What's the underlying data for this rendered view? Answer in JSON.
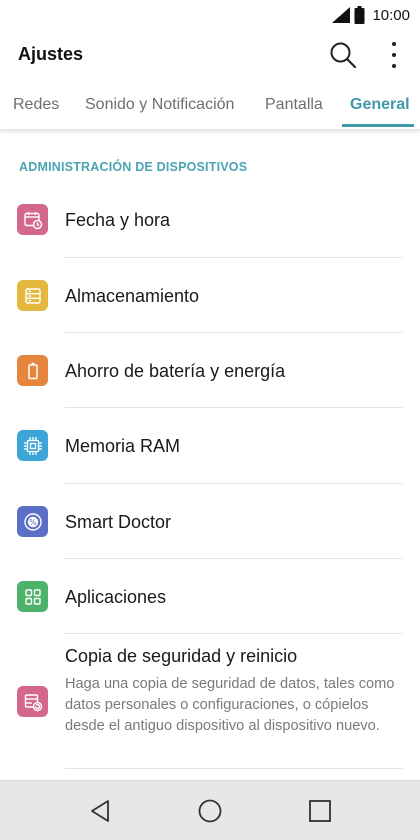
{
  "status_bar": {
    "time": "10:00"
  },
  "app_bar": {
    "title": "Ajustes"
  },
  "tabs": [
    {
      "label": "Redes",
      "active": false
    },
    {
      "label": "Sonido y Notificación",
      "active": false
    },
    {
      "label": "Pantalla",
      "active": false
    },
    {
      "label": "General",
      "active": true
    }
  ],
  "section": {
    "header": "ADMINISTRACIÓN DE DISPOSITIVOS"
  },
  "items": [
    {
      "label": "Fecha y hora",
      "icon": "calendar-clock-icon",
      "color": "#d3688a"
    },
    {
      "label": "Almacenamiento",
      "icon": "storage-icon",
      "color": "#e3b83d"
    },
    {
      "label": "Ahorro de batería y energía",
      "icon": "battery-icon",
      "color": "#e6853d"
    },
    {
      "label": "Memoria RAM",
      "icon": "chip-icon",
      "color": "#3ea5d8"
    },
    {
      "label": "Smart Doctor",
      "icon": "smart-doctor-icon",
      "color": "#5b6fc7"
    },
    {
      "label": "Aplicaciones",
      "icon": "apps-grid-icon",
      "color": "#4fb26a"
    },
    {
      "label": "Copia de seguridad y reinicio",
      "description": "Haga una copia de seguridad de datos, tales como datos personales o configuraciones, o cópielos desde el antiguo dispositivo al dispositivo nuevo.",
      "icon": "backup-restore-icon",
      "color": "#d3688a"
    }
  ],
  "colors": {
    "accent": "#3e9aa8",
    "section_header": "#4aa4b3",
    "nav_bar": "#e7e7e7"
  }
}
